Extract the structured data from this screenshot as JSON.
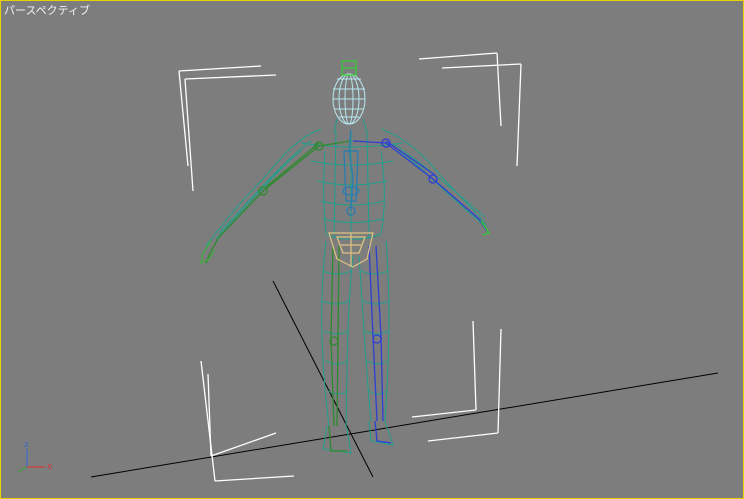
{
  "viewport": {
    "label": "パースペクティブ",
    "border_color": "#e6d200",
    "background_color": "#7d7d7d"
  },
  "gizmo": {
    "x_label": "x",
    "z_label": "z",
    "x_color": "#d23c3c",
    "z_color": "#3c6ad2"
  },
  "model": {
    "mesh_color": "#1fa08c",
    "head_color": "#b7e6ef",
    "left_limb_color": "#2e8a2e",
    "right_limb_color": "#2d3fd4",
    "pelvis_color": "#e0c483",
    "selection_bracket_color": "#ffffff",
    "grid_line_color": "#000000"
  }
}
